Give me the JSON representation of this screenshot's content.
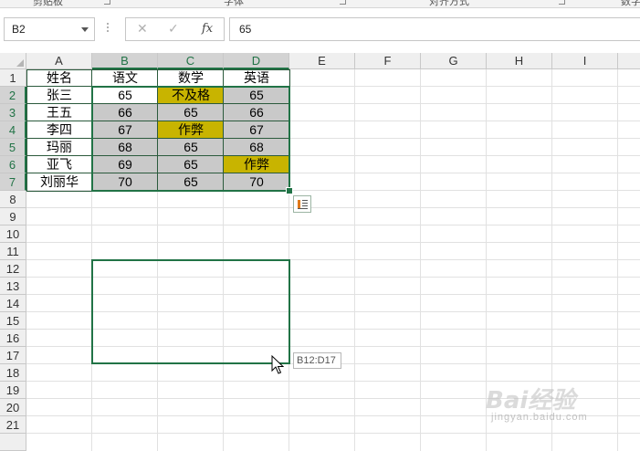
{
  "ribbon": {
    "groups": [
      {
        "label": "剪贴板"
      },
      {
        "label": "字体"
      },
      {
        "label": "对齐方式"
      },
      {
        "label": "数字"
      }
    ]
  },
  "formula_bar": {
    "name_box": "B2",
    "cancel_icon": "cancel-icon",
    "enter_icon": "enter-icon",
    "function_label": "fx",
    "value": "65"
  },
  "columns": [
    "A",
    "B",
    "C",
    "D",
    "E",
    "F",
    "G",
    "H",
    "I"
  ],
  "rows": [
    "1",
    "2",
    "3",
    "4",
    "5",
    "6",
    "7",
    "8",
    "9",
    "10",
    "11",
    "12",
    "13",
    "14",
    "15",
    "16",
    "17",
    "18",
    "19",
    "20",
    "21"
  ],
  "sheet": {
    "header": [
      "姓名",
      "语文",
      "数学",
      "英语"
    ],
    "records": [
      [
        "张三",
        "65",
        "不及格",
        "65"
      ],
      [
        "王五",
        "66",
        "65",
        "66"
      ],
      [
        "李四",
        "67",
        "作弊",
        "67"
      ],
      [
        "玛丽",
        "68",
        "65",
        "68"
      ],
      [
        "亚飞",
        "69",
        "65",
        "作弊"
      ],
      [
        "刘丽华",
        "70",
        "65",
        "70"
      ]
    ]
  },
  "colors": {
    "selection": "#217346",
    "highlight_yellow": "#c8b400",
    "fill_gray": "#c9c9c9",
    "table_border": "#2b5a3c"
  },
  "quick_analysis_icon": "quick-analysis-icon",
  "selection_tooltip": "B12:D17",
  "watermark": {
    "logo": "Bai经验",
    "url": "jingyan.baidu.com"
  }
}
